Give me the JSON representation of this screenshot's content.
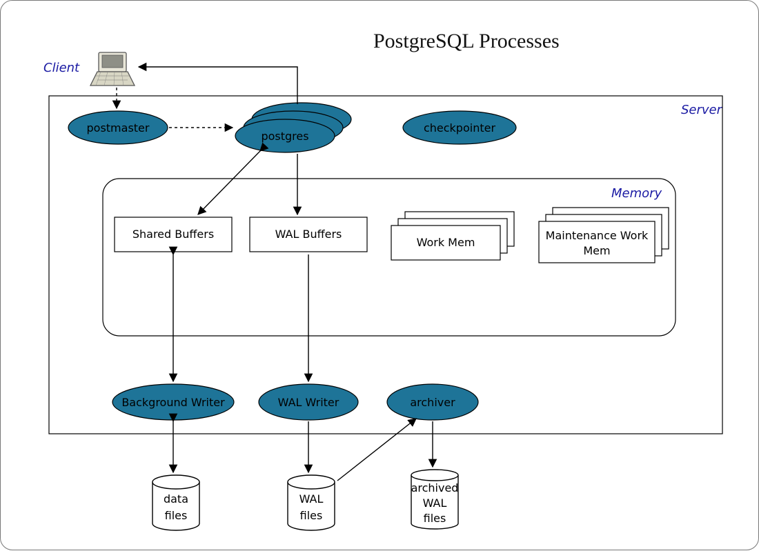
{
  "title": "PostgreSQL Processes",
  "labels": {
    "client": "Client",
    "server": "Server",
    "memory": "Memory"
  },
  "nodes": {
    "postmaster": "postmaster",
    "postgres": "postgres",
    "checkpointer": "checkpointer",
    "shared_buffers": "Shared Buffers",
    "wal_buffers": "WAL Buffers",
    "work_mem": "Work Mem",
    "maintenance_work_mem": "Maintenance Work",
    "maintenance_work_mem2": "Mem",
    "background_writer": "Background Writer",
    "wal_writer": "WAL Writer",
    "archiver": "archiver",
    "data_files_1": "data",
    "data_files_2": "files",
    "wal_files_1": "WAL",
    "wal_files_2": "files",
    "archived_wal_1": "archived",
    "archived_wal_2": "WAL",
    "archived_wal_3": "files"
  }
}
